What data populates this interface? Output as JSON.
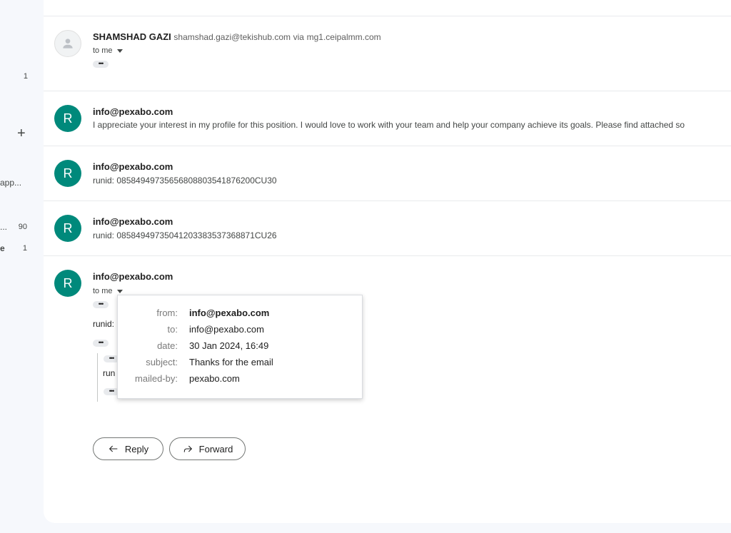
{
  "sidebar": {
    "count_1": "1",
    "truncated_label": "app...",
    "ellipsis_label": "...",
    "count_2": "90",
    "e_label": "e",
    "count_3": "1"
  },
  "messages": [
    {
      "sender": "SHAMSHAD GAZI",
      "email": "shamshad.gazi@tekishub.com",
      "via_label": "via",
      "via_domain": "mg1.ceipalmm.com",
      "to": "to me"
    },
    {
      "avatar": "R",
      "sender": "info@pexabo.com",
      "snippet": "I appreciate your interest in my profile for this position. I would love to work with your team and help your company achieve its goals. Please find attached so"
    },
    {
      "avatar": "R",
      "sender": "info@pexabo.com",
      "snippet": "runid: 0858494973565680880354187620​0CU30"
    },
    {
      "avatar": "R",
      "sender": "info@pexabo.com",
      "snippet": "runid: 08584949735041203383537368871CU26"
    },
    {
      "avatar": "R",
      "sender": "info@pexabo.com",
      "to": "to me",
      "body_runid": "runid:",
      "quote_text": "run"
    }
  ],
  "popup": {
    "from_label": "from:",
    "from_value": "info@pexabo.com",
    "to_label": "to:",
    "to_value": "info@pexabo.com",
    "date_label": "date:",
    "date_value": "30 Jan 2024, 16:49",
    "subject_label": "subject:",
    "subject_value": "Thanks for the email",
    "mailedby_label": "mailed-by:",
    "mailedby_value": "pexabo.com"
  },
  "actions": {
    "reply_label": "Reply",
    "forward_label": "Forward"
  },
  "colors": {
    "avatar_green": "#00897b",
    "background": "#f6f8fc"
  }
}
